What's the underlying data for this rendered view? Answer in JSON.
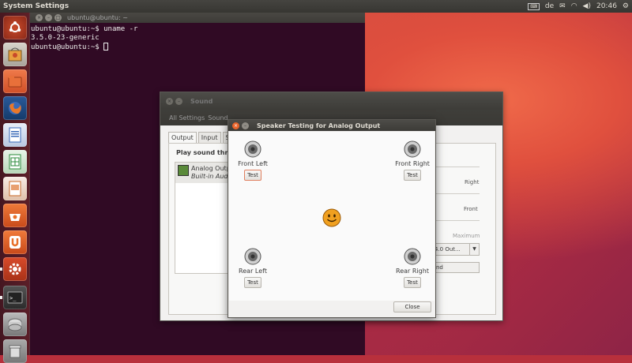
{
  "top_panel": {
    "title": "System Settings",
    "keyboard_layout": "de",
    "time": "20:46",
    "indicators": [
      "keyboard-icon",
      "network-wifi-icon",
      "mail-icon",
      "volume-icon",
      "gear-icon"
    ]
  },
  "launcher": {
    "items": [
      "ubuntu-dash-icon",
      "software-center-icon",
      "files-icon",
      "firefox-icon",
      "libreoffice-writer-icon",
      "libreoffice-calc-icon",
      "libreoffice-impress-icon",
      "ubuntu-software-icon",
      "ubuntu-one-icon",
      "system-settings-icon",
      "terminal-icon",
      "disks-icon",
      "trash-icon"
    ]
  },
  "terminal": {
    "title": "ubuntu@ubuntu: ~",
    "lines": [
      "ubuntu@ubuntu:~$ uname -r",
      "3.5.0-23-generic",
      "ubuntu@ubuntu:~$ "
    ]
  },
  "sound_window": {
    "title": "Sound",
    "breadcrumb_all": "All Settings",
    "breadcrumb_current": "Sound",
    "tabs": [
      "Output",
      "Input",
      "S"
    ],
    "play_sound_label": "Play sound thro",
    "device_name": "Analog Outp",
    "device_sub": "Built-in Audi",
    "right_labels": {
      "balance_right": "Right",
      "fade_front": "Front",
      "volume_max": "Maximum"
    },
    "profile_value": "4.0 Out...",
    "test_sound_button": "nd"
  },
  "speaker_dialog": {
    "title": "Speaker Testing for Analog Output",
    "speakers": {
      "front_left": {
        "label": "Front Left",
        "button": "Test"
      },
      "front_right": {
        "label": "Front Right",
        "button": "Test"
      },
      "rear_left": {
        "label": "Rear Left",
        "button": "Test"
      },
      "rear_right": {
        "label": "Rear Right",
        "button": "Test"
      }
    },
    "close_button": "Close"
  },
  "colors": {
    "terminal_bg": "#300a24",
    "close_button": "#e9642b",
    "panel": "#3c3b37"
  }
}
